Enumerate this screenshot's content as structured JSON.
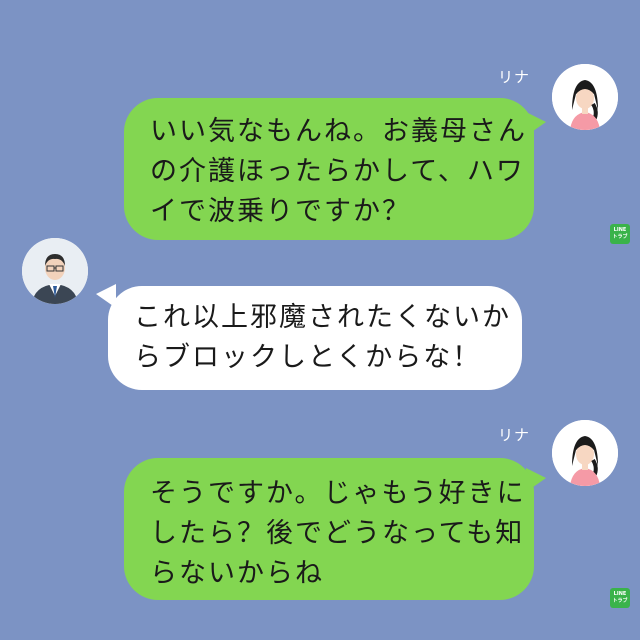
{
  "messages": [
    {
      "sender": "リナ",
      "side": "right",
      "lines": [
        "いい気なもんね。お義母さん",
        "の介護ほったらかして、ハワ",
        "イで波乗りですか？"
      ]
    },
    {
      "sender": "",
      "side": "left",
      "lines": [
        "これ以上邪魔されたくないか",
        "らブロックしとくからな！"
      ]
    },
    {
      "sender": "リナ",
      "side": "right",
      "lines": [
        "そうですか。じゃもう好きに",
        "したら？後でどうなっても知",
        "らないからね"
      ]
    }
  ],
  "watermark": {
    "line1": "LINE",
    "line2": "トラブ"
  },
  "colors": {
    "background": "#7c93c4",
    "sent_bubble": "#83d651",
    "received_bubble": "#ffffff"
  }
}
